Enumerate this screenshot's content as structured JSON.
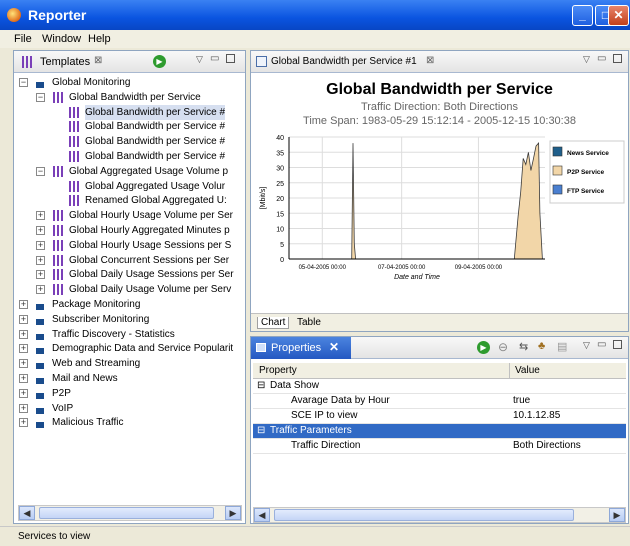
{
  "window": {
    "title": "Reporter"
  },
  "menu": [
    "File",
    "Window",
    "Help"
  ],
  "templates_view": {
    "tab_label": "Templates",
    "tree": [
      {
        "label": "Global Monitoring",
        "level": 0,
        "expanded": true,
        "kind": "folder"
      },
      {
        "label": "Global Bandwidth per Service",
        "level": 1,
        "expanded": true,
        "kind": "bars"
      },
      {
        "label": "Global Bandwidth per Service #",
        "level": 2,
        "kind": "bars",
        "selected": true
      },
      {
        "label": "Global Bandwidth per Service #",
        "level": 2,
        "kind": "bars"
      },
      {
        "label": "Global Bandwidth per Service #",
        "level": 2,
        "kind": "bars"
      },
      {
        "label": "Global Bandwidth per Service #",
        "level": 2,
        "kind": "bars"
      },
      {
        "label": "Global Aggregated Usage Volume p",
        "level": 1,
        "expanded": true,
        "kind": "bars"
      },
      {
        "label": "Global Aggregated Usage Volur",
        "level": 2,
        "kind": "bars"
      },
      {
        "label": "Renamed Global Aggregated U:",
        "level": 2,
        "kind": "bars"
      },
      {
        "label": "Global Hourly Usage Volume per Ser",
        "level": 1,
        "expanded": false,
        "kind": "bars"
      },
      {
        "label": "Global Hourly Aggregated Minutes p",
        "level": 1,
        "expanded": false,
        "kind": "bars"
      },
      {
        "label": "Global Hourly Usage Sessions per S",
        "level": 1,
        "expanded": false,
        "kind": "bars"
      },
      {
        "label": "Global Concurrent Sessions per Ser",
        "level": 1,
        "expanded": false,
        "kind": "bars"
      },
      {
        "label": "Global Daily Usage Sessions per Ser",
        "level": 1,
        "expanded": false,
        "kind": "bars"
      },
      {
        "label": "Global Daily Usage Volume per Serv",
        "level": 1,
        "expanded": false,
        "kind": "bars"
      },
      {
        "label": "Package Monitoring",
        "level": 0,
        "expanded": false,
        "kind": "folder"
      },
      {
        "label": "Subscriber Monitoring",
        "level": 0,
        "expanded": false,
        "kind": "folder"
      },
      {
        "label": "Traffic Discovery - Statistics",
        "level": 0,
        "expanded": false,
        "kind": "folder"
      },
      {
        "label": "Demographic Data and Service Popularit",
        "level": 0,
        "expanded": false,
        "kind": "folder"
      },
      {
        "label": "Web and Streaming",
        "level": 0,
        "expanded": false,
        "kind": "folder"
      },
      {
        "label": "Mail and News",
        "level": 0,
        "expanded": false,
        "kind": "folder"
      },
      {
        "label": "P2P",
        "level": 0,
        "expanded": false,
        "kind": "folder"
      },
      {
        "label": "VoIP",
        "level": 0,
        "expanded": false,
        "kind": "folder"
      },
      {
        "label": "Malicious Traffic",
        "level": 0,
        "expanded": false,
        "kind": "folder"
      }
    ]
  },
  "chart_view": {
    "tab_label": "Global Bandwidth per Service #1",
    "sub_tabs": [
      "Chart",
      "Table"
    ],
    "active_sub_tab": "Chart"
  },
  "chart_data": {
    "type": "area",
    "title": "Global Bandwidth per Service",
    "subtitle": "Traffic Direction: Both Directions",
    "time_span": "Time Span: 1983-05-29 15:12:14 - 2005-12-15 10:30:38",
    "xlabel": "Date and Time",
    "ylabel": "[Mbit/s]",
    "ylim": [
      0,
      40
    ],
    "y_ticks": [
      "0",
      "5",
      "10",
      "15",
      "20",
      "25",
      "30",
      "35",
      "40"
    ],
    "x_tick_labels": [
      "05-04-2005 00:00",
      "07-04-2005 00:00",
      "09-04-2005 00:00"
    ],
    "x_ticks_frac": [
      0.13,
      0.44,
      0.74
    ],
    "legend": [
      "News Service",
      "P2P Service",
      "FTP Service"
    ],
    "legend_colors": [
      "#1f5f8b",
      "#f2d6a8",
      "#4a7fd0"
    ],
    "series": [
      {
        "name": "P2P Service",
        "x_frac": [
          0.0,
          0.245,
          0.25,
          0.255,
          0.26,
          0.88,
          0.895,
          0.905,
          0.915,
          0.925,
          0.935,
          0.945,
          0.955,
          0.965,
          0.975,
          0.98,
          0.99,
          1.0
        ],
        "values": [
          0,
          0,
          38,
          5,
          0,
          0,
          14,
          22,
          33,
          31,
          35,
          29,
          33,
          37,
          38,
          15,
          0,
          0
        ]
      }
    ]
  },
  "properties_view": {
    "tab_label": "Properties",
    "columns": [
      "Property",
      "Value"
    ],
    "rows": [
      {
        "property": "Data Show",
        "value": "",
        "group": true,
        "selected": false
      },
      {
        "property": "Avarage Data by Hour",
        "value": "true",
        "group": false,
        "selected": false
      },
      {
        "property": "SCE IP to view",
        "value": "10.1.12.85",
        "group": false,
        "selected": false
      },
      {
        "property": "Traffic Parameters",
        "value": "",
        "group": true,
        "selected": true
      },
      {
        "property": "Traffic Direction",
        "value": "Both Directions",
        "group": false,
        "selected": false
      }
    ]
  },
  "status": {
    "text": "Services to view"
  }
}
